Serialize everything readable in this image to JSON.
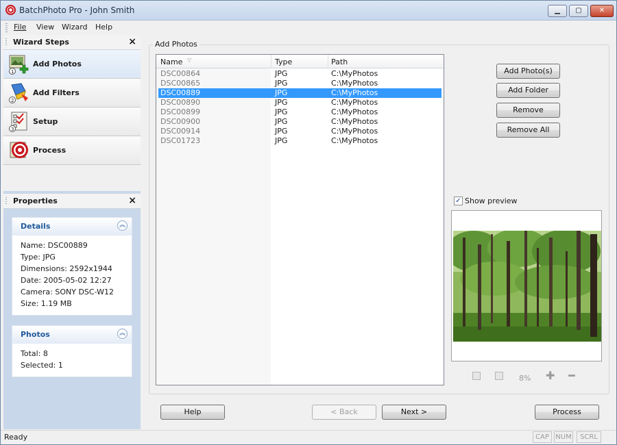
{
  "window": {
    "title": "BatchPhoto Pro - John Smith"
  },
  "menu": {
    "file": "File",
    "view": "View",
    "wizard": "Wizard",
    "help": "Help"
  },
  "wizard_steps": {
    "title": "Wizard Steps",
    "close": "×",
    "items": [
      {
        "label": "Add Photos",
        "active": true,
        "icon": "add-photos-icon"
      },
      {
        "label": "Add Filters",
        "active": false,
        "icon": "add-filters-icon"
      },
      {
        "label": "Setup",
        "active": false,
        "icon": "setup-icon"
      },
      {
        "label": "Process",
        "active": false,
        "icon": "process-icon"
      }
    ]
  },
  "properties": {
    "title": "Properties",
    "close": "×",
    "details": {
      "title": "Details",
      "lines": [
        "Name: DSC00889",
        "Type: JPG",
        "Dimensions: 2592x1944",
        "Date: 2005-05-02 12:27",
        "Camera: SONY DSC-W12",
        "Size: 1.19 MB"
      ]
    },
    "photos": {
      "title": "Photos",
      "lines": [
        "Total: 8",
        "Selected: 1"
      ]
    }
  },
  "add_photos": {
    "group_label": "Add Photos",
    "columns": {
      "name": "Name",
      "type": "Type",
      "path": "Path"
    },
    "rows": [
      {
        "name": "DSC00864",
        "type": "JPG",
        "path": "C:\\MyPhotos",
        "selected": false
      },
      {
        "name": "DSC00865",
        "type": "JPG",
        "path": "C:\\MyPhotos",
        "selected": false
      },
      {
        "name": "DSC00889",
        "type": "JPG",
        "path": "C:\\MyPhotos",
        "selected": true
      },
      {
        "name": "DSC00890",
        "type": "JPG",
        "path": "C:\\MyPhotos",
        "selected": false
      },
      {
        "name": "DSC00899",
        "type": "JPG",
        "path": "C:\\MyPhotos",
        "selected": false
      },
      {
        "name": "DSC00900",
        "type": "JPG",
        "path": "C:\\MyPhotos",
        "selected": false
      },
      {
        "name": "DSC00914",
        "type": "JPG",
        "path": "C:\\MyPhotos",
        "selected": false
      },
      {
        "name": "DSC01723",
        "type": "JPG",
        "path": "C:\\MyPhotos",
        "selected": false
      }
    ],
    "buttons": {
      "add_photos": "Add Photo(s)",
      "add_folder": "Add Folder",
      "remove": "Remove",
      "remove_all": "Remove All"
    },
    "show_preview": {
      "label": "Show preview",
      "checked": true
    },
    "zoom": {
      "percent": "8%"
    }
  },
  "nav": {
    "help": "Help",
    "back": "< Back",
    "next": "Next >",
    "process": "Process"
  },
  "status": {
    "text": "Ready",
    "cap": "CAP",
    "num": "NUM",
    "scrl": "SCRL"
  },
  "colors": {
    "selection": "#3399ff",
    "panel_bg": "#c9d7ea",
    "card_title": "#215a9a"
  }
}
